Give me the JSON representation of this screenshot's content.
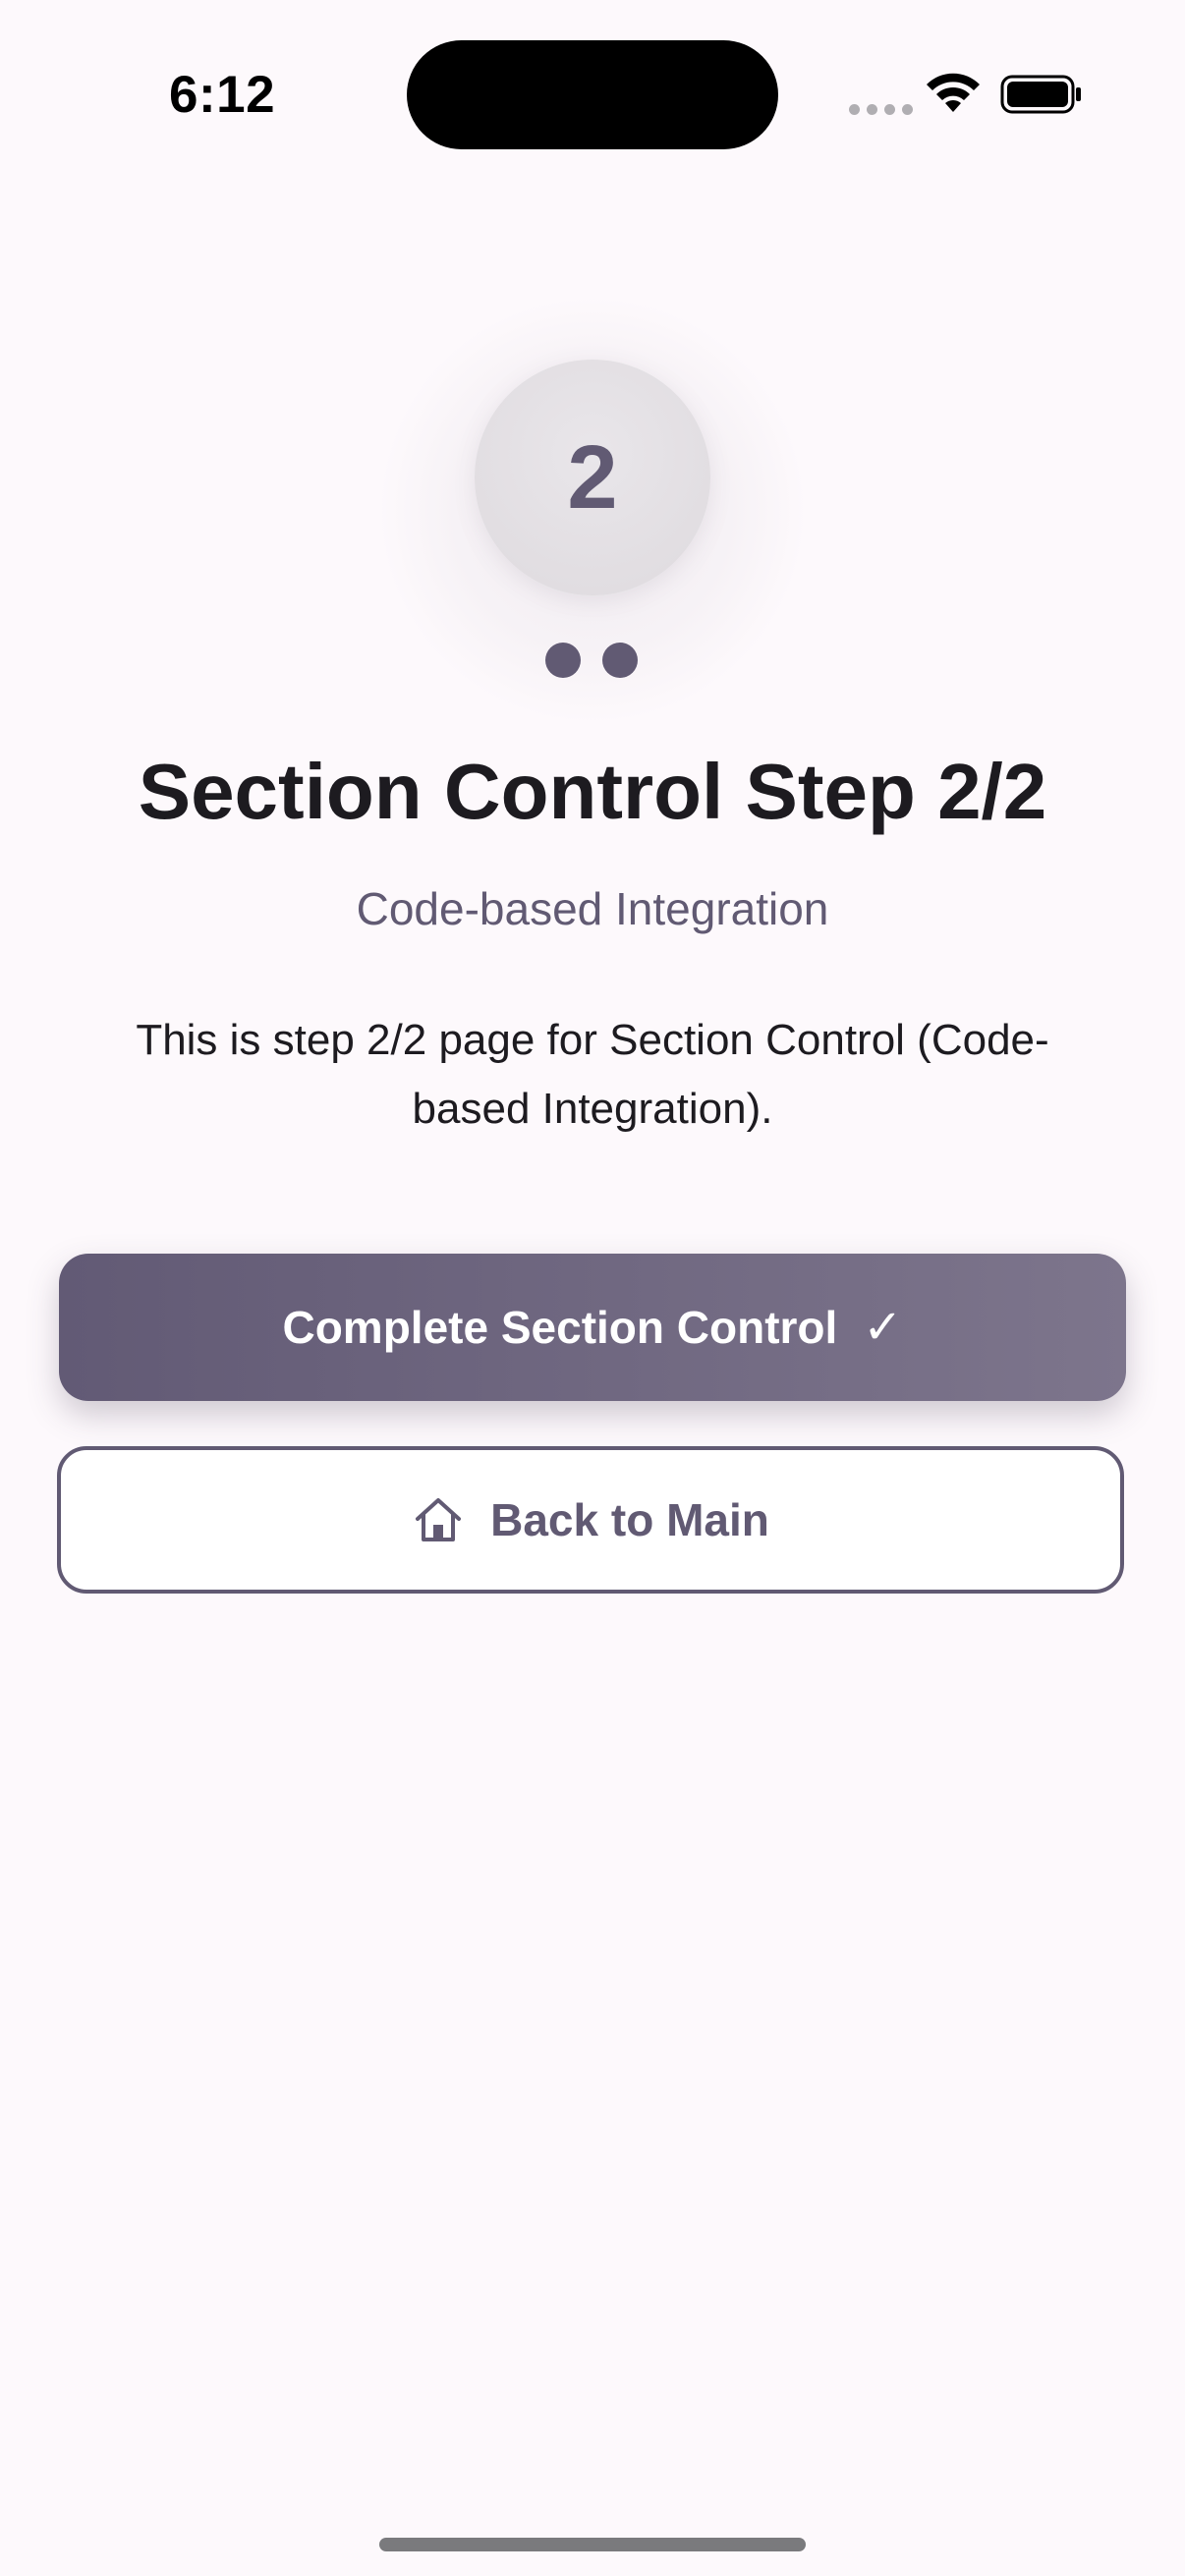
{
  "status_bar": {
    "time": "6:12",
    "icons": [
      "signal-dots-icon",
      "wifi-icon",
      "battery-icon"
    ]
  },
  "step": {
    "number": "2",
    "total_dots": 2
  },
  "title": "Section Control Step 2/2",
  "subtitle": "Code-based Integration",
  "description": "This is step 2/2 page for Section Control (Code-based Integration).",
  "actions": {
    "complete_label": "Complete Section Control",
    "complete_icon": "✓",
    "back_label": "Back to Main"
  },
  "colors": {
    "accent": "#615a73",
    "background": "#fdf9fc",
    "badge": "#e2dfe3"
  }
}
